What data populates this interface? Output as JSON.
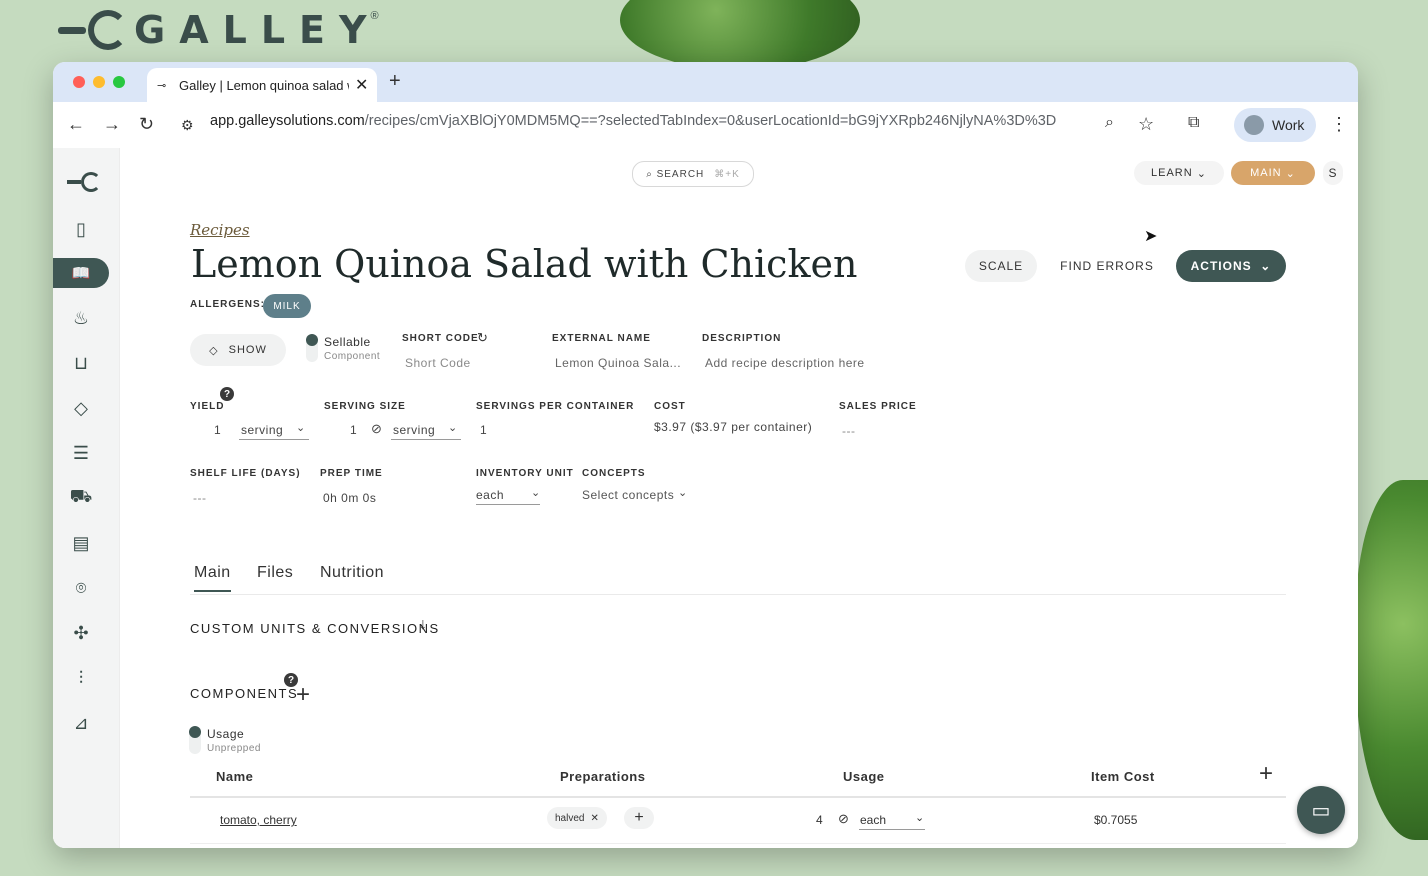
{
  "brand": {
    "wordmark": "GALLEY",
    "reg": "®"
  },
  "browser": {
    "tab_title": "Galley | Lemon quinoa salad w",
    "url_host": "app.galleysolutions.com",
    "url_path": "/recipes/cmVjaXBlOjY0MDM5MQ==?selectedTabIndex=0&userLocationId=bG9jYXRpb246NjlyNA%3D%3D",
    "profile_label": "Work"
  },
  "topbar": {
    "search_label": "SEARCH",
    "search_kbd": "⌘+K",
    "learn_label": "LEARN",
    "main_label": "MAIN",
    "user_initial": "S"
  },
  "sidebar": {
    "items": [
      {
        "icon": "clipboard-icon",
        "glyph": "▯"
      },
      {
        "icon": "recipe-book-icon",
        "glyph": "📖"
      },
      {
        "icon": "ingredient-icon",
        "glyph": "♨"
      },
      {
        "icon": "containers-icon",
        "glyph": "⊔"
      },
      {
        "icon": "tag-icon",
        "glyph": "◇"
      },
      {
        "icon": "menu-list-icon",
        "glyph": "☰"
      },
      {
        "icon": "cart-icon",
        "glyph": "⛟"
      },
      {
        "icon": "document-icon",
        "glyph": "▤"
      },
      {
        "icon": "location-pin-icon",
        "glyph": "⌾"
      },
      {
        "icon": "dining-icon",
        "glyph": "✣"
      },
      {
        "icon": "sliders-icon",
        "glyph": "⫶"
      },
      {
        "icon": "report-icon",
        "glyph": "⊿"
      }
    ]
  },
  "recipe": {
    "breadcrumb": "Recipes",
    "title": "Lemon Quinoa Salad with Chicken",
    "buttons": {
      "scale": "SCALE",
      "find_errors": "FIND ERRORS",
      "actions": "ACTIONS"
    },
    "allergens_label": "ALLERGENS:",
    "allergens": [
      "MILK"
    ],
    "show_label": "SHOW",
    "sellable_on": "Sellable",
    "sellable_off": "Component",
    "short_code_label": "SHORT CODE",
    "short_code_placeholder": "Short Code",
    "external_name_label": "EXTERNAL NAME",
    "external_name_value": "Lemon Quinoa Sala...",
    "description_label": "DESCRIPTION",
    "description_placeholder": "Add recipe description here",
    "yield_label": "YIELD",
    "yield_qty": "1",
    "yield_unit": "serving",
    "serving_size_label": "SERVING SIZE",
    "serving_size_qty": "1",
    "serving_size_unit": "serving",
    "servings_per_container_label": "SERVINGS PER CONTAINER",
    "servings_per_container_value": "1",
    "cost_label": "COST",
    "cost_value": "$3.97 ($3.97 per container)",
    "sales_price_label": "SALES PRICE",
    "sales_price_value": "---",
    "shelf_life_label": "SHELF LIFE (DAYS)",
    "shelf_life_value": "---",
    "prep_time_label": "PREP TIME",
    "prep_time_value": "0h 0m 0s",
    "inventory_unit_label": "INVENTORY UNIT",
    "inventory_unit_value": "each",
    "concepts_label": "CONCEPTS",
    "concepts_placeholder": "Select concepts"
  },
  "page_tabs": [
    "Main",
    "Files",
    "Nutrition"
  ],
  "sections": {
    "custom_units": "CUSTOM UNITS & CONVERSIONS",
    "components": "COMPONENTS",
    "usage_on": "Usage",
    "usage_off": "Unprepped"
  },
  "table": {
    "headers": [
      "Name",
      "Preparations",
      "Usage",
      "Item Cost"
    ],
    "rows": [
      {
        "name": "tomato, cherry",
        "preparation": "halved",
        "usage_qty": "4",
        "usage_unit": "each",
        "item_cost": "$0.7055"
      }
    ]
  }
}
